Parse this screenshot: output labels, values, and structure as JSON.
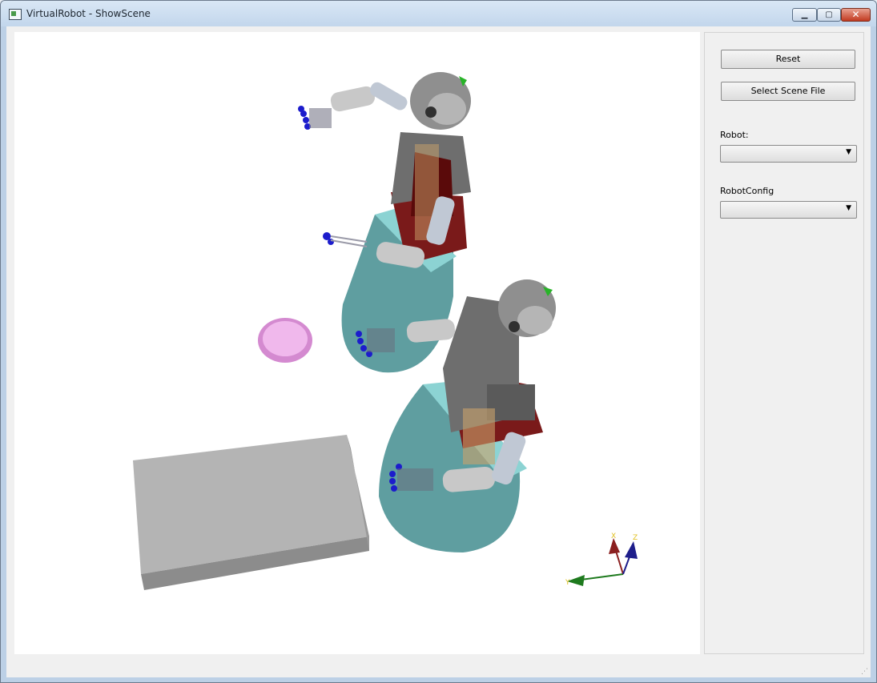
{
  "window": {
    "title": "VirtualRobot - ShowScene",
    "minimize_glyph": "▁",
    "maximize_glyph": "▢",
    "close_glyph": "✕"
  },
  "panel": {
    "reset_label": "Reset",
    "select_scene_label": "Select Scene File",
    "robot_label": "Robot:",
    "robot_value": "",
    "robotconfig_label": "RobotConfig",
    "robotconfig_value": ""
  },
  "axes": {
    "x_label": "X",
    "y_label": "Y",
    "z_label": "Z"
  },
  "icons": {
    "dropdown": "▼",
    "size_grip": "⋰"
  },
  "colors": {
    "robot_base": "#5f9ea0",
    "plate": "#e8a0e0",
    "box": "#b4b4b4",
    "x_axis": "#8b2020",
    "y_axis": "#1e7a1e",
    "z_axis": "#1e1e8b"
  }
}
